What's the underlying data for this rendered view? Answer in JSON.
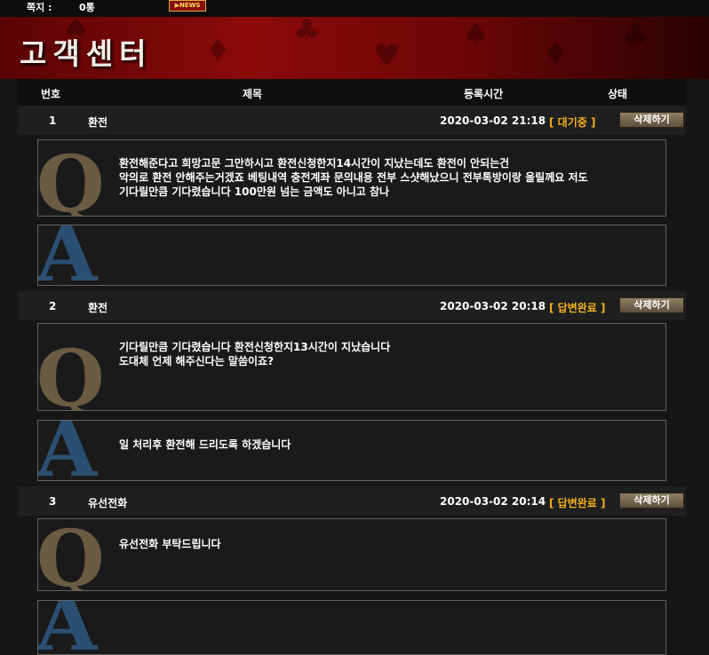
{
  "topbar": {
    "message_label": "쪽지 :",
    "message_count": "0통",
    "news_label": "▶NEWS"
  },
  "banner": {
    "title": "고객센터"
  },
  "table_header": {
    "no": "번호",
    "subject": "제목",
    "registered": "등록시간",
    "status": "상태"
  },
  "delete_label": "삭제하기",
  "entries": [
    {
      "no": "1",
      "subject": "환전",
      "date": "2020-03-02 21:18",
      "status": "[ 대기중 ]",
      "question_lines": [
        "환전해준다고 희망고문 그만하시고 환전신청한지14시간이 지났는데도 환전이 안되는건",
        "악의로 환전 안해주는거겠죠 베팅내역 충전계좌 문의내용 전부 스샷해났으니 전부톡방이랑 올릴께요 저도",
        "기다릴만큼 기다렸습니다 100만원 넘는 금액도 아니고 참나"
      ],
      "answer_lines": []
    },
    {
      "no": "2",
      "subject": "환전",
      "date": "2020-03-02 20:18",
      "status": "[ 답변완료 ]",
      "question_lines": [
        "기다릴만큼 기다렸습니다 환전신청한지13시간이 지났습니다",
        "도대체 언제 해주신다는 말씀이죠?"
      ],
      "answer_lines": [
        "일 처리후 환전해 드리도록 하겠습니다"
      ]
    },
    {
      "no": "3",
      "subject": "유선전화",
      "date": "2020-03-02 20:14",
      "status": "[ 답변완료 ]",
      "question_lines": [
        "유선전화 부탁드립니다"
      ],
      "answer_lines": []
    }
  ],
  "colors": {
    "status": "#f2b01e",
    "banner": "#8b0a0a",
    "q_letter": "#6a5b42",
    "a_letter": "#2a4f72"
  }
}
